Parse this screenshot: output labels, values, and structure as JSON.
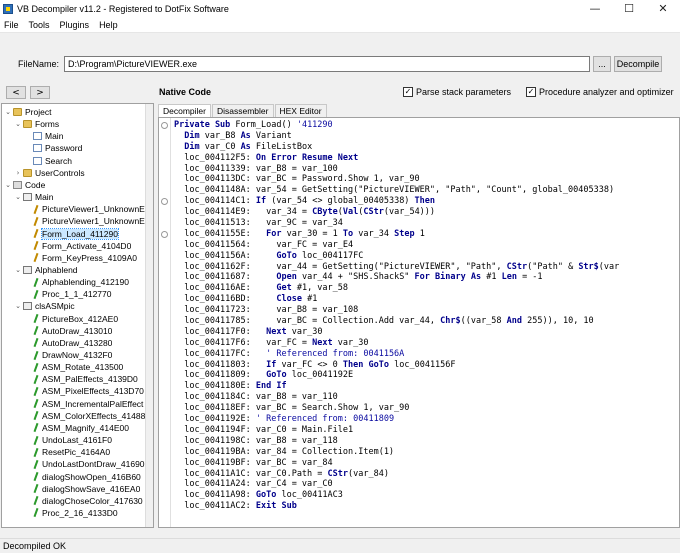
{
  "window": {
    "title": "VB Decompiler v11.2 - Registered to DotFix Software",
    "minimize": "—",
    "maximize": "☐",
    "close": "✕"
  },
  "menu": [
    "File",
    "Tools",
    "Plugins",
    "Help"
  ],
  "file": {
    "label": "FileName:",
    "value": "D:\\Program\\PictureVIEWER.exe",
    "browse": "...",
    "decompile": "Decompile"
  },
  "nav": {
    "back": "<",
    "forward": ">",
    "native_label": "Native Code"
  },
  "options": {
    "parse_stack": {
      "label": "Parse stack parameters",
      "checked": true
    },
    "proc_analyzer": {
      "label": "Procedure analyzer and optimizer",
      "checked": true
    }
  },
  "tree": [
    {
      "label": "Project",
      "depth": 0,
      "twisty": "⌄",
      "icon": "folder"
    },
    {
      "label": "Forms",
      "depth": 1,
      "twisty": "⌄",
      "icon": "folder"
    },
    {
      "label": "Main",
      "depth": 2,
      "twisty": "",
      "icon": "form"
    },
    {
      "label": "Password",
      "depth": 2,
      "twisty": "",
      "icon": "form"
    },
    {
      "label": "Search",
      "depth": 2,
      "twisty": "",
      "icon": "form"
    },
    {
      "label": "UserControls",
      "depth": 1,
      "twisty": "›",
      "icon": "folder"
    },
    {
      "label": "Code",
      "depth": 0,
      "twisty": "⌄",
      "icon": "code"
    },
    {
      "label": "Main",
      "depth": 1,
      "twisty": "⌄",
      "icon": "module"
    },
    {
      "label": "PictureViewer1_UnknownEv",
      "depth": 2,
      "twisty": "",
      "icon": "proc"
    },
    {
      "label": "PictureViewer1_UnknownEv",
      "depth": 2,
      "twisty": "",
      "icon": "proc"
    },
    {
      "label": "Form_Load_411290",
      "depth": 2,
      "twisty": "",
      "icon": "proc",
      "selected": true
    },
    {
      "label": "Form_Activate_4104D0",
      "depth": 2,
      "twisty": "",
      "icon": "proc"
    },
    {
      "label": "Form_KeyPress_4109A0",
      "depth": 2,
      "twisty": "",
      "icon": "proc"
    },
    {
      "label": "Alphablend",
      "depth": 1,
      "twisty": "⌄",
      "icon": "module"
    },
    {
      "label": "Alphablending_412190",
      "depth": 2,
      "twisty": "",
      "icon": "proc green"
    },
    {
      "label": "Proc_1_1_412770",
      "depth": 2,
      "twisty": "",
      "icon": "proc green"
    },
    {
      "label": "clsASMpic",
      "depth": 1,
      "twisty": "⌄",
      "icon": "module"
    },
    {
      "label": "PictureBox_412AE0",
      "depth": 2,
      "twisty": "",
      "icon": "proc green"
    },
    {
      "label": "AutoDraw_413010",
      "depth": 2,
      "twisty": "",
      "icon": "proc green"
    },
    {
      "label": "AutoDraw_413280",
      "depth": 2,
      "twisty": "",
      "icon": "proc green"
    },
    {
      "label": "DrawNow_4132F0",
      "depth": 2,
      "twisty": "",
      "icon": "proc green"
    },
    {
      "label": "ASM_Rotate_413500",
      "depth": 2,
      "twisty": "",
      "icon": "proc green"
    },
    {
      "label": "ASM_PalEffects_4139D0",
      "depth": 2,
      "twisty": "",
      "icon": "proc green"
    },
    {
      "label": "ASM_PixelEffects_413D70",
      "depth": 2,
      "twisty": "",
      "icon": "proc green"
    },
    {
      "label": "ASM_IncrementalPalEffect",
      "depth": 2,
      "twisty": "",
      "icon": "proc green"
    },
    {
      "label": "ASM_ColorXEffects_41488",
      "depth": 2,
      "twisty": "",
      "icon": "proc green"
    },
    {
      "label": "ASM_Magnify_414E00",
      "depth": 2,
      "twisty": "",
      "icon": "proc green"
    },
    {
      "label": "UndoLast_4161F0",
      "depth": 2,
      "twisty": "",
      "icon": "proc green"
    },
    {
      "label": "ResetPic_4164A0",
      "depth": 2,
      "twisty": "",
      "icon": "proc green"
    },
    {
      "label": "UndoLastDontDraw_41690",
      "depth": 2,
      "twisty": "",
      "icon": "proc green"
    },
    {
      "label": "dialogShowOpen_416B60",
      "depth": 2,
      "twisty": "",
      "icon": "proc green"
    },
    {
      "label": "dialogShowSave_416EA0",
      "depth": 2,
      "twisty": "",
      "icon": "proc green"
    },
    {
      "label": "dialogChoseColor_417630",
      "depth": 2,
      "twisty": "",
      "icon": "proc green"
    },
    {
      "label": "Proc_2_16_4133D0",
      "depth": 2,
      "twisty": "",
      "icon": "proc green"
    }
  ],
  "tabs": [
    {
      "label": "Decompiler",
      "active": true
    },
    {
      "label": "Disassembler",
      "active": false
    },
    {
      "label": "HEX Editor",
      "active": false
    }
  ],
  "code": [
    {
      "text": "Private Sub Form_Load() '411290",
      "fold": true
    },
    {
      "text": "  Dim var_B8 As Variant"
    },
    {
      "text": "  Dim var_C0 As FileListBox"
    },
    {
      "text": "  loc_004112F5: On Error Resume Next"
    },
    {
      "text": "  loc_00411339: var_B8 = var_100"
    },
    {
      "text": "  loc_004113DC: var_BC = Password.Show 1, var_90"
    },
    {
      "text": "  loc_0041148A: var_54 = GetSetting(\"PictureVIEWER\", \"Path\", \"Count\", global_00405338)"
    },
    {
      "text": "  loc_004114C1: If (var_54 <> global_00405338) Then",
      "fold": true
    },
    {
      "text": "  loc_004114E9:   var_34 = CByte(Val(CStr(var_54)))"
    },
    {
      "text": "  loc_00411513:   var_9C = var_34"
    },
    {
      "text": "  loc_0041155E:   For var_30 = 1 To var_34 Step 1",
      "fold": true
    },
    {
      "text": "  loc_00411564:     var_FC = var_E4"
    },
    {
      "text": "  loc_0041156A:     GoTo loc_004117FC"
    },
    {
      "text": "  loc_0041162F:     var_44 = GetSetting(\"PictureVIEWER\", \"Path\", CStr(\"Path\" & Str$(var"
    },
    {
      "text": "  loc_00411687:     Open var_44 + \"SHS.ShackS\" For Binary As #1 Len = -1"
    },
    {
      "text": "  loc_004116AE:     Get #1, var_58"
    },
    {
      "text": "  loc_004116BD:     Close #1"
    },
    {
      "text": "  loc_00411723:     var_B8 = var_108"
    },
    {
      "text": "  loc_00411785:     var_BC = Collection.Add var_44, Chr$((var_58 And 255)), 10, 10"
    },
    {
      "text": "  loc_004117F0:   Next var_30"
    },
    {
      "text": "  loc_004117F6:   var_FC = Next var_30"
    },
    {
      "text": "  loc_004117FC:   ' Referenced from: 0041156A"
    },
    {
      "text": "  loc_00411803:   If var_FC <> 0 Then GoTo loc_0041156F"
    },
    {
      "text": "  loc_00411809:   GoTo loc_0041192E"
    },
    {
      "text": "  loc_0041180E: End If"
    },
    {
      "text": "  loc_0041184C: var_B8 = var_110"
    },
    {
      "text": "  loc_004118EF: var_BC = Search.Show 1, var_90"
    },
    {
      "text": "  loc_0041192E: ' Referenced from: 00411809"
    },
    {
      "text": "  loc_0041194F: var_C0 = Main.File1"
    },
    {
      "text": "  loc_0041198C: var_B8 = var_118"
    },
    {
      "text": "  loc_004119BA: var_84 = Collection.Item(1)"
    },
    {
      "text": "  loc_004119BF: var_BC = var_84"
    },
    {
      "text": "  loc_00411A1C: var_C0.Path = CStr(var_84)"
    },
    {
      "text": "  loc_00411A24: var_C4 = var_C0"
    },
    {
      "text": "  loc_00411A98: GoTo loc_00411AC3"
    },
    {
      "text": "  loc_00411AC2: Exit Sub"
    }
  ],
  "keywords": [
    "Private Sub",
    "Dim",
    "As",
    "On Error Resume Next",
    "If",
    "Then",
    "For",
    "To",
    "Step",
    "GoTo",
    "Open",
    "For Binary",
    "Len",
    "Get",
    "Close",
    "Next",
    "End If",
    "Exit Sub",
    "CByte",
    "Val",
    "CStr",
    "Str$",
    "Chr$",
    "And"
  ],
  "status": "Decompiled OK"
}
